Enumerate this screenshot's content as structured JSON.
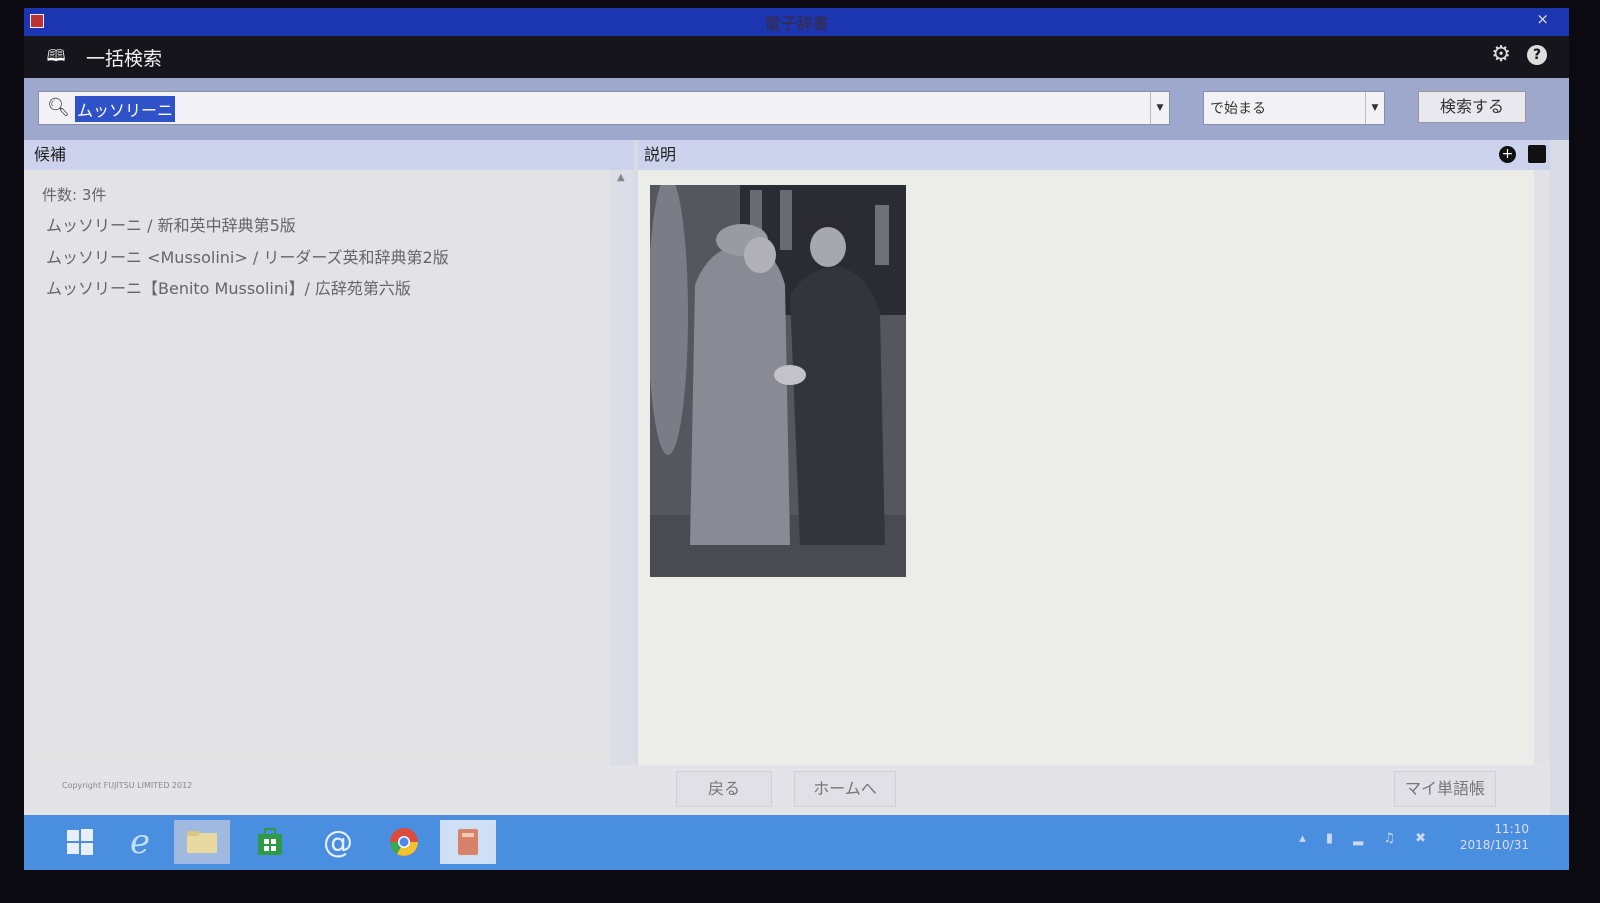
{
  "window": {
    "title": "電子辞書",
    "close": "×"
  },
  "appbar": {
    "title": "一括検索"
  },
  "search": {
    "query": "ムッソリーニ",
    "mode": "で始まる",
    "button": "検索する"
  },
  "candidates": {
    "header": "候補",
    "count": "件数: 3件",
    "items": [
      "ムッソリーニ / 新和英中辞典第5版",
      "ムッソリーニ <Mussolini> / リーダーズ英和辞典第2版",
      "ムッソリーニ【Benito Mussolini】/ 広辞苑第六版"
    ]
  },
  "description": {
    "header": "説明"
  },
  "bottom": {
    "copyright": "Copyright FUJITSU LIMITED 2012",
    "back": "戻る",
    "home": "ホームへ",
    "wordbook": "マイ単語帳"
  },
  "taskbar": {
    "time": "11:10",
    "date": "2018/10/31",
    "apps": [
      "start-icon",
      "internet-explorer-icon",
      "file-explorer-icon",
      "store-icon",
      "mail-icon",
      "chrome-icon",
      "dictionary-app-icon"
    ]
  },
  "colors": {
    "titlebar": "#1c35b0",
    "appbar": "#15151b",
    "taskbar": "#4a8ee0",
    "highlight": "#2f52c8"
  }
}
